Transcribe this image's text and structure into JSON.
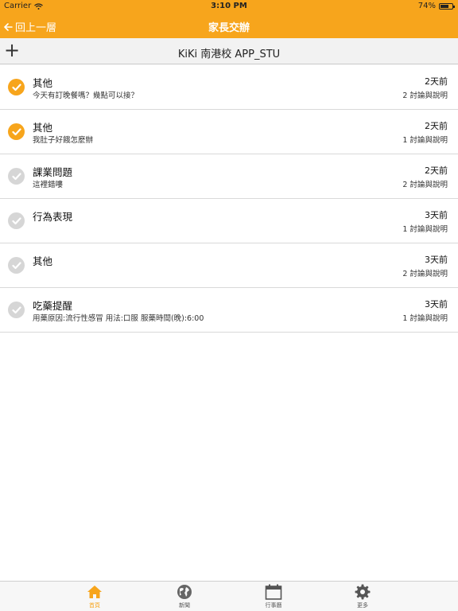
{
  "status_bar": {
    "carrier": "Carrier",
    "time": "3:10 PM",
    "battery_text": "74%",
    "battery_level": 0.74
  },
  "nav": {
    "back_label": "回上一層",
    "title": "家長交辦"
  },
  "toolbar": {
    "title": "KiKi 南港校 APP_STU",
    "add_symbol": "+"
  },
  "items": [
    {
      "label": "其他",
      "desc": "今天有訂晚餐嗎？幾點可以接？",
      "when": "2天前",
      "count": "2 討論與說明",
      "done": true
    },
    {
      "label": "其他",
      "desc": "我肚子好餓怎麼辦",
      "when": "2天前",
      "count": "1 討論與說明",
      "done": true
    },
    {
      "label": "課業問題",
      "desc": "這裡錯嘍",
      "when": "2天前",
      "count": "2 討論與說明",
      "done": false
    },
    {
      "label": "行為表現",
      "desc": "",
      "when": "3天前",
      "count": "1 討論與說明",
      "done": false
    },
    {
      "label": "其他",
      "desc": "",
      "when": "3天前",
      "count": "2 討論與說明",
      "done": false
    },
    {
      "label": "吃藥提醒",
      "desc": "用藥原因:流行性感冒 用法:口服 服藥時間(晚):6:00",
      "when": "3天前",
      "count": "1 討論與說明",
      "done": false
    }
  ],
  "tabs": [
    {
      "label": "首頁",
      "icon": "home-icon",
      "active": true
    },
    {
      "label": "新聞",
      "icon": "globe-icon",
      "active": false
    },
    {
      "label": "行事曆",
      "icon": "calendar-icon",
      "active": false
    },
    {
      "label": "更多",
      "icon": "gear-icon",
      "active": false
    }
  ],
  "colors": {
    "accent": "#f7a51c",
    "check_off": "#d6d6d6"
  }
}
